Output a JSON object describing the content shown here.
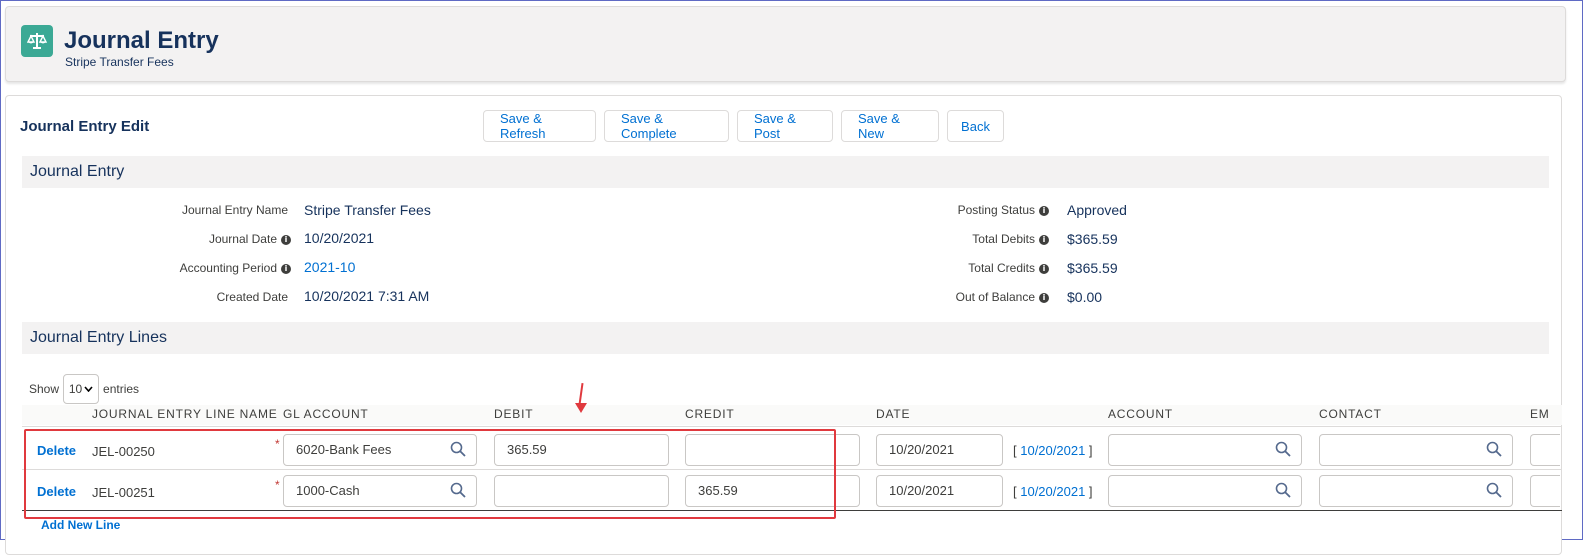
{
  "header": {
    "title": "Journal Entry",
    "subtitle": "Stripe Transfer Fees",
    "icon": "balance-scale-icon"
  },
  "card": {
    "title": "Journal Entry Edit",
    "buttons": [
      "Save & Refresh",
      "Save & Complete",
      "Save & Post",
      "Save & New",
      "Back"
    ]
  },
  "section_info": {
    "title": "Journal Entry"
  },
  "fields_left": [
    {
      "label": "Journal Entry Name",
      "value": "Stripe Transfer Fees",
      "info": false,
      "link": false
    },
    {
      "label": "Journal Date",
      "value": "10/20/2021",
      "info": true,
      "link": false
    },
    {
      "label": "Accounting Period",
      "value": "2021-10",
      "info": true,
      "link": true
    },
    {
      "label": "Created Date",
      "value": "10/20/2021 7:31 AM",
      "info": false,
      "link": false
    }
  ],
  "fields_right": [
    {
      "label": "Posting Status",
      "value": "Approved",
      "info": true
    },
    {
      "label": "Total Debits",
      "value": "$365.59",
      "info": true
    },
    {
      "label": "Total Credits",
      "value": "$365.59",
      "info": true
    },
    {
      "label": "Out of Balance",
      "value": "$0.00",
      "info": true
    }
  ],
  "section_lines": {
    "title": "Journal Entry Lines"
  },
  "table": {
    "show_label": "Show",
    "page_size": "10",
    "entries_label": "entries",
    "columns": [
      "JOURNAL ENTRY LINE NAME",
      "GL ACCOUNT",
      "DEBIT",
      "CREDIT",
      "DATE",
      "ACCOUNT",
      "CONTACT",
      "EM"
    ],
    "rows": [
      {
        "action": "Delete",
        "name": "JEL-00250",
        "gl_account": "6020-Bank Fees",
        "debit": "365.59",
        "credit": "",
        "date": "10/20/2021",
        "date_link": "10/20/2021",
        "account": "",
        "contact": ""
      },
      {
        "action": "Delete",
        "name": "JEL-00251",
        "gl_account": "1000-Cash",
        "debit": "",
        "credit": "365.59",
        "date": "10/20/2021",
        "date_link": "10/20/2021",
        "account": "",
        "contact": ""
      }
    ],
    "add_line": "Add New Line"
  },
  "colors": {
    "accent": "#0070d2",
    "title": "#16325c",
    "icon_bg": "#3ba995",
    "annotation": "#e0393e"
  }
}
